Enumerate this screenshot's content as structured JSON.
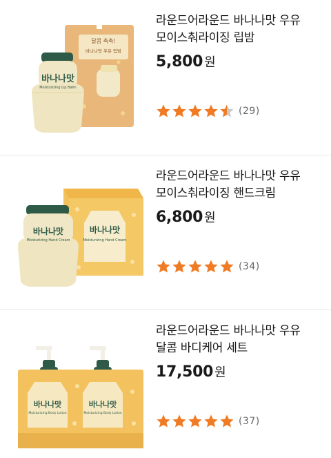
{
  "colors": {
    "star": "#f07b25",
    "star_empty": "#c9c9c9",
    "box_yellow": "#f3c25e",
    "cap_green": "#2e5a47",
    "cream": "#f0e7c6"
  },
  "products": [
    {
      "title_line1": "라운드어라운드 바나나맛 우유",
      "title_line2": "모이스춰라이징 립밤",
      "price": "5,800",
      "currency": "원",
      "rating": 4.5,
      "review_count": "(29)",
      "image_icon": "banana-milk-lip-balm-image",
      "image_text": {
        "brand": "바나나맛",
        "sub": "Moisturizing Lip Balm",
        "card_top": "달콤 촉촉!",
        "card_sub": "바나나맛 우유 립밤"
      }
    },
    {
      "title_line1": "라운드어라운드 바나나맛 우유",
      "title_line2": "모이스춰라이징 핸드크림",
      "price": "6,800",
      "currency": "원",
      "rating": 5,
      "review_count": "(34)",
      "image_icon": "banana-milk-hand-cream-image",
      "image_text": {
        "brand": "바나나맛",
        "sub": "Moisturizing Hand Cream"
      }
    },
    {
      "title_line1": "라운드어라운드 바나나맛 우유",
      "title_line2": "달콤 바디케어 세트",
      "price": "17,500",
      "currency": "원",
      "rating": 5,
      "review_count": "(37)",
      "image_icon": "banana-milk-body-care-set-image",
      "image_text": {
        "brand": "바나나맛",
        "sub": "Moisturizing Body Lotion"
      }
    }
  ]
}
